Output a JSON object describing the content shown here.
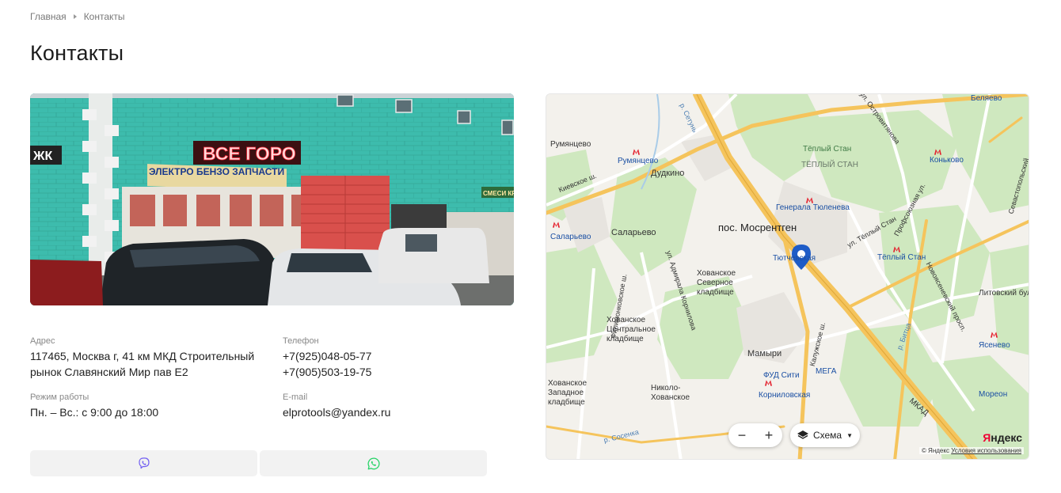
{
  "breadcrumb": {
    "home": "Главная",
    "current": "Контакты"
  },
  "page_title": "Контакты",
  "photo": {
    "sign_main": "ВСЕ ГОРО",
    "sign_sub": "ЭЛЕКТРО  БЕНЗО  ЗАПЧАСТИ",
    "sign_small": "СМЕСИ КРАСК",
    "sign_left": "ЖК"
  },
  "contacts": {
    "address_label": "Адрес",
    "address_line1": "117465, Москва г, 41 км МКД Строительный",
    "address_line2": "рынок Славянский Мир пав Е2",
    "phone_label": "Телефон",
    "phone1": "+7(925)048-05-77",
    "phone2": "+7(905)503-19-75",
    "hours_label": "Режим работы",
    "hours": "Пн. – Вс.: с 9:00 до 18:00",
    "email_label": "E-mail",
    "email": "elprotools@yandex.ru"
  },
  "messengers": {
    "viber_icon": "viber-icon",
    "whatsapp_icon": "whatsapp-icon",
    "viber_color": "#7360f2",
    "whatsapp_color": "#25d366"
  },
  "map": {
    "labels": {
      "rumyantsevo": "Румянцево",
      "rumyantsevo_metro": "Румянцево",
      "dudkino": "Дудкино",
      "salaryevo_metro": "Саларьево",
      "salaryevo": "Саларьево",
      "mosrentgen": "пос. Мосрентген",
      "teply_stan_park": "Тёплый Стан",
      "teply_stan_district": "ТЁПЛЫЙ СТАН",
      "konkovo": "Коньково",
      "generala_tyuleneva": "Генерала Тюленева",
      "teply_stan_metro": "Тёплый Стан",
      "tyutchevskaya": "Тютчевская",
      "khovanskoe_north": "Хованское Северное кладбище",
      "khovanskoe_central": "Хованское Центральное кладбище",
      "khovanskoe_west": "Хованское Западное кладбище",
      "mamyri": "Мамыри",
      "fud_siti": "ФУД Сити",
      "mega": "МЕГА",
      "korneliovskaya": "Корниловская",
      "nikolo_khovanskoe": "Николо-Хованское",
      "yasenevo": "Ясенево",
      "litovsky": "Литовский бул.",
      "moreon": "Мореон",
      "mkad": "МКАД",
      "belyaevo": "Беляево",
      "kievskoe": "Киевское ш.",
      "profsoyuznaya": "Профсоюзная ул.",
      "novoyasenevsky": "Новоясеневский просп.",
      "sosenka": "р. Сосенка",
      "bitsa": "р. Битца",
      "admirala_kornilova": "ул. Адмирала Корнилова",
      "filimonkovskoe": "Филимонковское ш.",
      "setun": "р. Сетунь",
      "ostrovityanova": "ул. Островитянова",
      "teply_stan_street": "ул. Тёплый Стан",
      "sevastopolsky": "Севастопольский",
      "kaluzhskoe": "Калужское ш."
    },
    "zoom_out": "−",
    "zoom_in": "+",
    "scheme": "Схема",
    "yandex_logo_a": "Я",
    "yandex_logo_b": "ндекс",
    "copyright": "© Яндекс",
    "terms": "Условия использования",
    "metro_color": "#e4202d",
    "road_color": "#f5c45c",
    "park_color": "#cfe8bf"
  }
}
